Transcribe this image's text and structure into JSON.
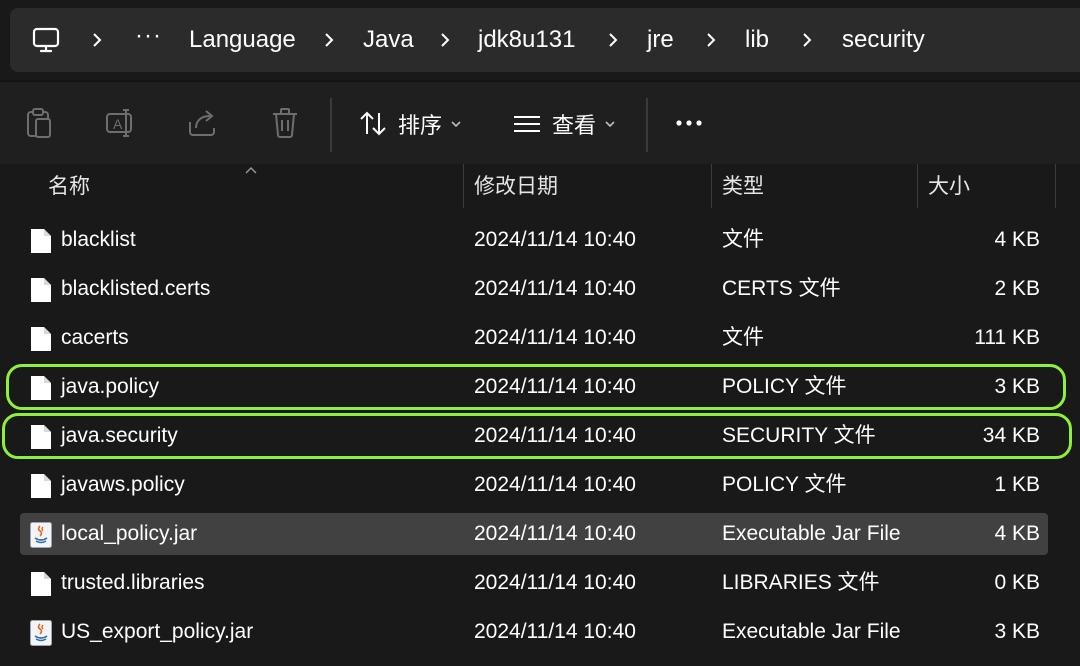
{
  "breadcrumb": {
    "overflow": "···",
    "items": [
      "Language",
      "Java",
      "jdk8u131",
      "jre",
      "lib",
      "security"
    ]
  },
  "toolbar": {
    "sort_label": "排序",
    "view_label": "查看",
    "more_label": "•••"
  },
  "columns": {
    "name": "名称",
    "date": "修改日期",
    "type": "类型",
    "size": "大小"
  },
  "files": [
    {
      "name": "blacklist",
      "date": "2024/11/14 10:40",
      "type": "文件",
      "size": "4 KB",
      "icon": "file-icon"
    },
    {
      "name": "blacklisted.certs",
      "date": "2024/11/14 10:40",
      "type": "CERTS 文件",
      "size": "2 KB",
      "icon": "file-icon"
    },
    {
      "name": "cacerts",
      "date": "2024/11/14 10:40",
      "type": "文件",
      "size": "111 KB",
      "icon": "file-icon"
    },
    {
      "name": "java.policy",
      "date": "2024/11/14 10:40",
      "type": "POLICY 文件",
      "size": "3 KB",
      "icon": "file-icon"
    },
    {
      "name": "java.security",
      "date": "2024/11/14 10:40",
      "type": "SECURITY 文件",
      "size": "34 KB",
      "icon": "file-icon"
    },
    {
      "name": "javaws.policy",
      "date": "2024/11/14 10:40",
      "type": "POLICY 文件",
      "size": "1 KB",
      "icon": "file-icon"
    },
    {
      "name": "local_policy.jar",
      "date": "2024/11/14 10:40",
      "type": "Executable Jar File",
      "size": "4 KB",
      "icon": "java-jar-icon"
    },
    {
      "name": "trusted.libraries",
      "date": "2024/11/14 10:40",
      "type": "LIBRARIES 文件",
      "size": "0 KB",
      "icon": "file-icon"
    },
    {
      "name": "US_export_policy.jar",
      "date": "2024/11/14 10:40",
      "type": "Executable Jar File",
      "size": "3 KB",
      "icon": "java-jar-icon"
    }
  ],
  "selected_file": "local_policy.jar",
  "highlighted_files": [
    "java.policy",
    "java.security"
  ],
  "colors": {
    "background": "#191919",
    "selected_row": "#414141",
    "highlight_outline": "#8ef038"
  }
}
